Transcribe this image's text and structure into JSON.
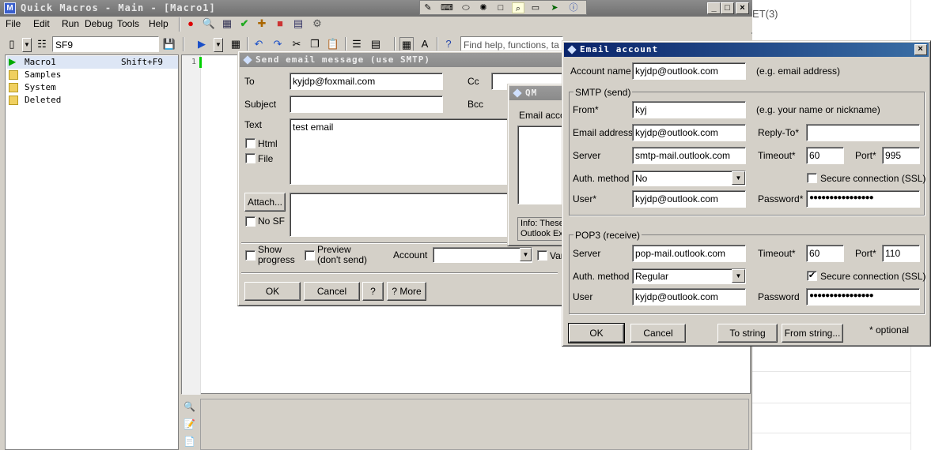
{
  "main_window": {
    "title": "Quick Macros - Main - [Macro1]",
    "menu": [
      "File",
      "Edit",
      "Run",
      "Debug",
      "Tools",
      "Help"
    ],
    "toolbar_combo_value": "SF9",
    "help_search_placeholder": "Find help, functions, ta",
    "line_number": "1"
  },
  "background_text": "ET(3)",
  "tree": {
    "items": [
      {
        "label": "Macro1",
        "hotkey": "Shift+F9"
      },
      {
        "label": "Samples"
      },
      {
        "label": "System"
      },
      {
        "label": "Deleted"
      }
    ]
  },
  "send_dialog": {
    "title": "Send email message (use SMTP)",
    "to_label": "To",
    "to_value": "kyjdp@foxmail.com",
    "cc_label": "Cc",
    "subject_label": "Subject",
    "bcc_label": "Bcc",
    "text_label": "Text",
    "text_value": "test email",
    "html_label": "Html",
    "file_label": "File",
    "attach_label": "Attach...",
    "nosf_label": "No SF",
    "show_progress_label": "Show progress",
    "preview_label": "Preview (don't send)",
    "account_label": "Account",
    "var_label": "Var",
    "ok": "OK",
    "cancel": "Cancel",
    "question": "?",
    "more": "? More"
  },
  "qm_dialog": {
    "title": "QM Email",
    "email_account_label": "Email accou",
    "info_line1": "Info: These",
    "info_line2": "Outlook Ex"
  },
  "account_dialog": {
    "title": "Email account",
    "account_name_label": "Account name",
    "account_name_value": "kyjdp@outlook.com",
    "account_name_hint": "(e.g. email address)",
    "smtp_group": "SMTP (send)",
    "from_label": "From*",
    "from_value": "kyj",
    "from_hint": "(e.g. your name or nickname)",
    "email_address_label": "Email address",
    "email_address_value": "kyjdp@outlook.com",
    "reply_to_label": "Reply-To*",
    "smtp_server_label": "Server",
    "smtp_server_value": "smtp-mail.outlook.com",
    "smtp_timeout_label": "Timeout*",
    "smtp_timeout_value": "60",
    "smtp_port_label": "Port*",
    "smtp_port_value": "995",
    "smtp_auth_label": "Auth. method",
    "smtp_auth_value": "No",
    "smtp_ssl_label": "Secure connection (SSL)",
    "smtp_ssl_checked": false,
    "smtp_user_label": "User*",
    "smtp_user_value": "kyjdp@outlook.com",
    "smtp_password_label": "Password*",
    "smtp_password_value": "●●●●●●●●●●●●●●●●",
    "pop3_group": "POP3 (receive)",
    "pop_server_label": "Server",
    "pop_server_value": "pop-mail.outlook.com",
    "pop_timeout_label": "Timeout*",
    "pop_timeout_value": "60",
    "pop_port_label": "Port*",
    "pop_port_value": "110",
    "pop_auth_label": "Auth. method",
    "pop_auth_value": "Regular",
    "pop_ssl_label": "Secure connection (SSL)",
    "pop_ssl_checked": true,
    "pop_user_label": "User",
    "pop_user_value": "kyjdp@outlook.com",
    "pop_password_label": "Password",
    "pop_password_value": "●●●●●●●●●●●●●●●●",
    "ok": "OK",
    "cancel": "Cancel",
    "to_string": "To string",
    "from_string": "From string...",
    "optional_note": "* optional"
  },
  "colors": {
    "dialog_face": "#d4d0c8",
    "active_title": "#0a246a",
    "inactive_title": "#8a8a8a"
  }
}
